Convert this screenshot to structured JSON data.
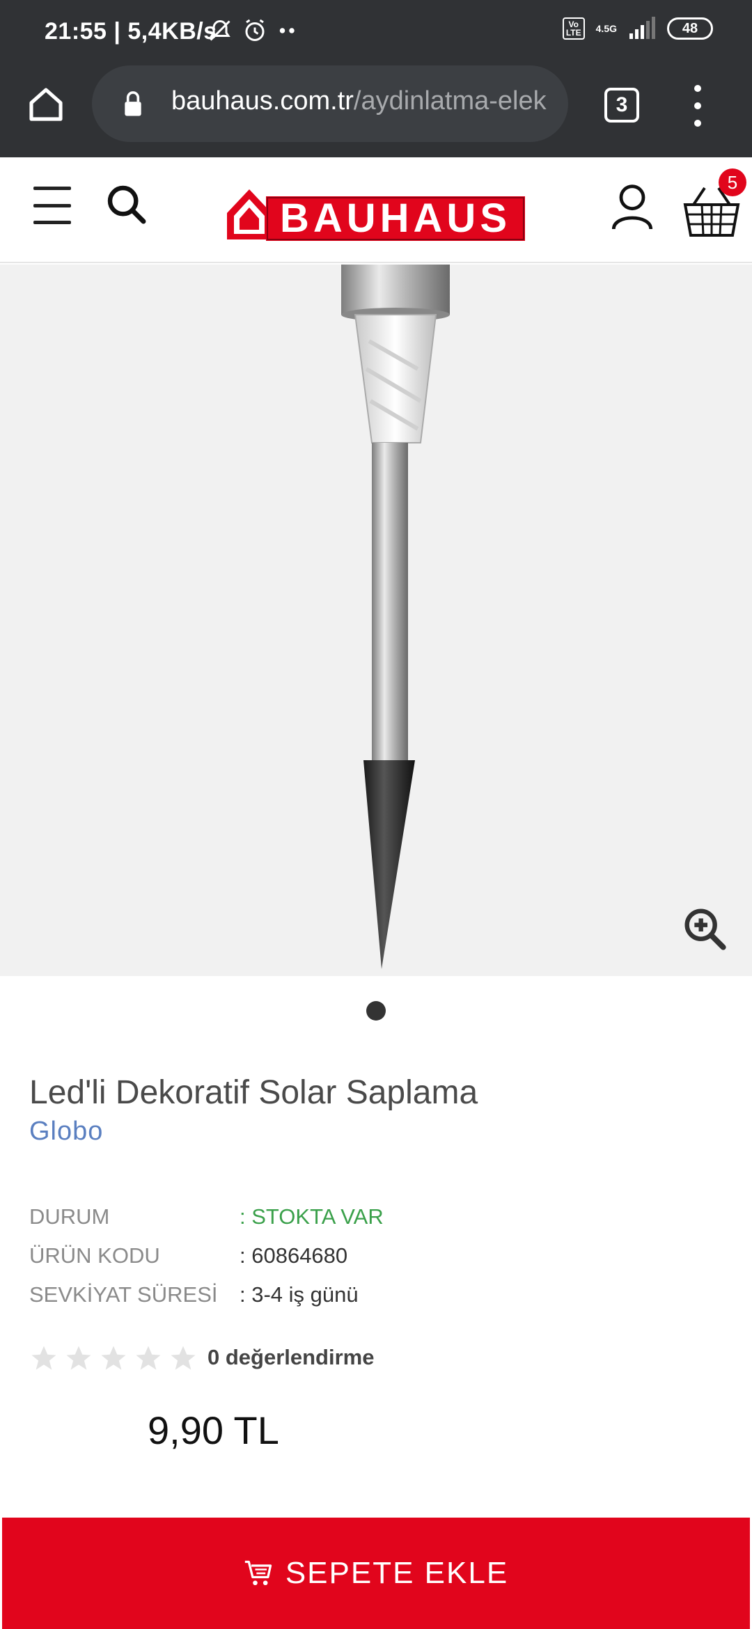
{
  "status_bar": {
    "time": "21:55",
    "speed": "| 5,4KB/s",
    "network_type": "4.5G",
    "volte": "Vo\nLTE",
    "battery": "48"
  },
  "browser": {
    "url_domain": "bauhaus.com.tr",
    "url_path": "/aydinlatma-elek",
    "tab_count": "3"
  },
  "header": {
    "logo_text": "BAUHAUS",
    "cart_count": "5"
  },
  "product": {
    "title": "Led'li Dekoratif Solar Saplama",
    "brand": "Globo",
    "specs": [
      {
        "label": "DURUM",
        "value": ": STOKTA VAR"
      },
      {
        "label": "ÜRÜN KODU",
        "value": ": 60864680"
      },
      {
        "label": "SEVKİYAT SÜRESİ",
        "value": ": 3-4 iş günü"
      }
    ],
    "rating": 0,
    "rating_max": 5,
    "rating_text": "0 değerlendirme",
    "price": "9,90 TL",
    "add_to_cart": "SEPETE EKLE"
  },
  "colors": {
    "brand_red": "#e1051c",
    "in_stock_green": "#3aa04a",
    "brand_link_blue": "#5a7fc0"
  },
  "icons": [
    "home-icon",
    "lock-icon",
    "tabs-icon",
    "more-icon",
    "menu-icon",
    "search-icon",
    "account-icon",
    "cart-icon",
    "zoom-icon",
    "star-icon",
    "cart-add-icon"
  ]
}
